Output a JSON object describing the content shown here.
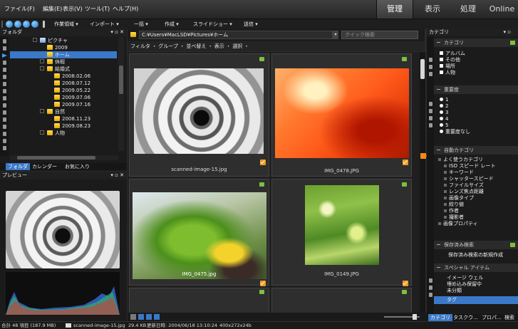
{
  "menu": {
    "items": [
      "ファイル(F)",
      "編集(E)",
      "表示(V)",
      "ツール(T)",
      "ヘルプ(H)"
    ],
    "mode_tabs": [
      "管理",
      "表示",
      "処理",
      "Online"
    ]
  },
  "toolbar": {
    "items": [
      "作業領域 ▾",
      "インポート ▾",
      "一括 ▾",
      "作成 ▾",
      "スライドショー ▾",
      "送信 ▾"
    ]
  },
  "folder_panel": {
    "title": "フォルダ",
    "controls": "▾ ▫ ✕",
    "tree": [
      {
        "label": "ピクチャ",
        "type": "blue"
      },
      {
        "label": "2009",
        "type": "folder"
      },
      {
        "label": "ホーム",
        "type": "folder"
      },
      {
        "label": "休暇",
        "type": "folder"
      },
      {
        "label": "結婚式",
        "type": "folder"
      },
      {
        "label": "2008.02.06",
        "type": "folder"
      },
      {
        "label": "2008.07.12",
        "type": "folder"
      },
      {
        "label": "2009.05.22",
        "type": "folder"
      },
      {
        "label": "2009.07.06",
        "type": "folder"
      },
      {
        "label": "2009.07.16",
        "type": "folder"
      },
      {
        "label": "自然",
        "type": "folder"
      },
      {
        "label": "2008.11.23",
        "type": "folder"
      },
      {
        "label": "2009.08.23",
        "type": "folder"
      },
      {
        "label": "人物",
        "type": "folder"
      }
    ],
    "tabs": [
      "フォルダ",
      "カレンダー",
      "お気に入り"
    ]
  },
  "preview_panel": {
    "title": "プレビュー",
    "controls": "▾ ▫ ✕"
  },
  "browser": {
    "path": "C:¥Users¥MacLSD¥Pictures¥ホーム",
    "search_placeholder": "クイック検索",
    "filter_bar": "フィルタ ・ グループ ・ 並べ替え ・ 表示 ・ 選択 ・",
    "thumbnails": [
      {
        "name": "scanned-image-15.jpg",
        "kind": "stairs"
      },
      {
        "name": "IMG_0478.JPG",
        "kind": "flamingo"
      },
      {
        "name": "IMG_0475.jpg",
        "kind": "parrot"
      },
      {
        "name": "IMG_0149.JPG",
        "kind": "leaves"
      }
    ]
  },
  "category_panel": {
    "title": "カテゴリ",
    "sections": {
      "categories": "カテゴリ",
      "importance": "重要度",
      "auto": "自動カテゴリ",
      "saved": "保存済み検索",
      "special": "スペシャル アイテム"
    },
    "category_items": [
      "アルバム",
      "その他",
      "場所",
      "人物"
    ],
    "importance_items": [
      "1",
      "2",
      "3",
      "4",
      "5",
      "重要度なし"
    ],
    "auto_items": [
      "よく使うカテゴリ",
      "ISO スピード レート",
      "キーワード",
      "シャッタースピード",
      "ファイルサイズ",
      "レンズ焦点距離",
      "画像タイプ",
      "絞り値",
      "作者",
      "撮影者",
      "画像プロパティ"
    ],
    "saved_action": "保存済み検索の新規作成",
    "special_items": [
      "イメージ ウェル",
      "埋め込み保留中",
      "未分類",
      "タグ"
    ],
    "bottom_tabs": [
      "カテゴリ",
      "タスクウ...",
      "プロパ...",
      "検索"
    ]
  },
  "status": {
    "summary": "合計 48 項目 (187.9 MB)",
    "file": "scanned-image-15.jpg",
    "size": "29.4 KB",
    "modified": "更新日時: 2004/06/18 13:10:24",
    "dimensions": "400x272x24b"
  },
  "colors": {
    "accent_blue": "#3a78c8",
    "accent_orange": "#f09a20",
    "bg": "#2a2a2a"
  }
}
